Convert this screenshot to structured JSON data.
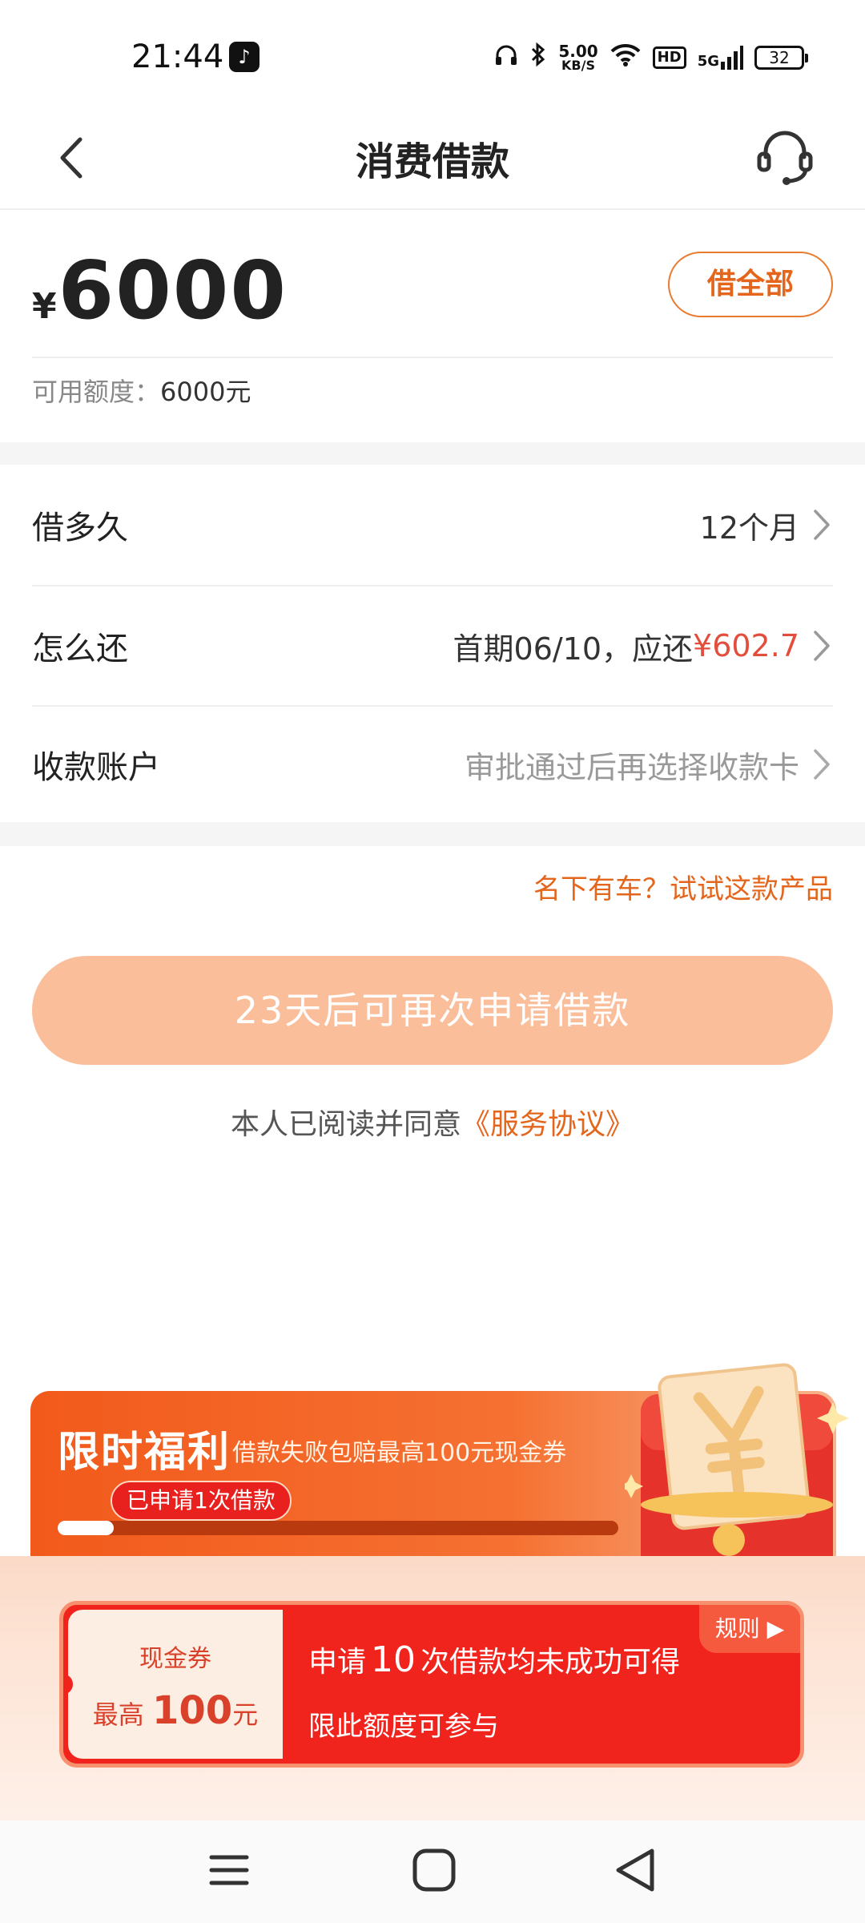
{
  "status_bar": {
    "time": "21:44",
    "app_icon": "tiktok-icon",
    "speed_value": "5.00",
    "speed_unit": "KB/S",
    "hd": "HD",
    "network": "5G",
    "battery": "32"
  },
  "nav": {
    "title": "消费借款",
    "back_icon": "chevron-left-icon",
    "service_icon": "headset-icon"
  },
  "amount": {
    "currency": "¥",
    "value": "6000",
    "borrow_all_label": "借全部",
    "quota_label": "可用额度：",
    "quota_value": "6000元"
  },
  "options": {
    "term_label": "借多久",
    "term_value": "12个月",
    "repay_label": "怎么还",
    "repay_value": "首期06/10，应还",
    "repay_amount": "¥602.7",
    "account_label": "收款账户",
    "account_value": "审批通过后再选择收款卡"
  },
  "car_link": "名下有车？试试这款产品",
  "apply_button": "23天后可再次申请借款",
  "agreement": {
    "text": "本人已阅读并同意",
    "link": "《服务协议》"
  },
  "promo": {
    "title": "限时福利",
    "subtitle": "借款失败包赔最高100元现金券",
    "badge": "已申请1次借款",
    "progress": 0.1
  },
  "coupon": {
    "title": "现金券",
    "max_prefix": "最高",
    "max_amount": "100",
    "max_unit": "元",
    "cond_prefix": "申请",
    "cond_count": "10",
    "cond_suffix": "次借款均未成功可得",
    "note": "限此额度可参与",
    "rules": "规则 ▶"
  },
  "colors": {
    "accent": "#e4651c",
    "button": "#fbbe9a",
    "red": "#e34d3c"
  }
}
